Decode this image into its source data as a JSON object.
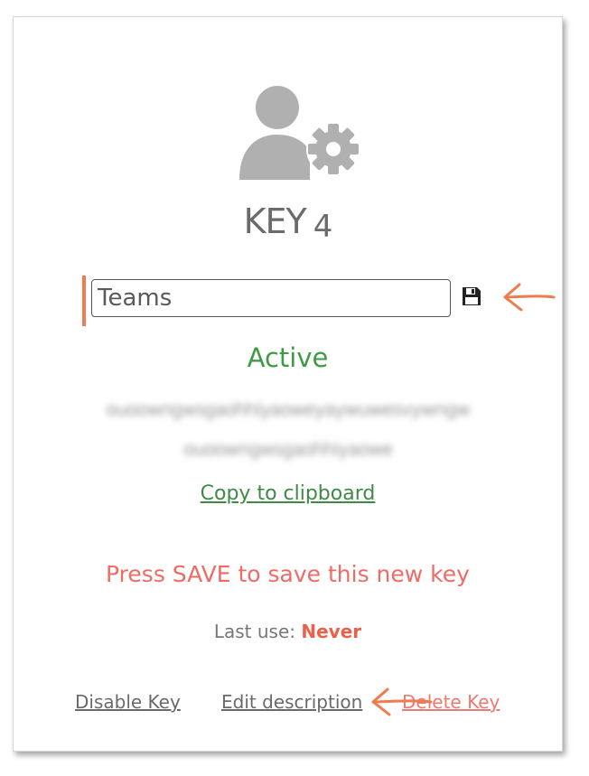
{
  "key": {
    "title_prefix": "KEY",
    "number": "4",
    "description_value": "Teams",
    "status": "Active",
    "masked_key_line1": "ouoowngwsgaohhiyaoweyaywuwesvywngw",
    "masked_key_line2": "ouoowngwsgaohhiyaowe",
    "copy_label": "Copy to clipboard",
    "save_warning": "Press SAVE to save this new key",
    "last_use_label": "Last use:",
    "last_use_value": "Never"
  },
  "actions": {
    "disable_label": "Disable Key",
    "edit_label": "Edit description",
    "delete_label": "Delete Key"
  },
  "icons": {
    "avatar": "user-gear-icon",
    "save": "floppy-disk-icon"
  },
  "colors": {
    "status_active": "#3f9a46",
    "warning": "#ee6b66",
    "never": "#ee5f4a",
    "annotation_arrow": "#ef7b4f"
  }
}
